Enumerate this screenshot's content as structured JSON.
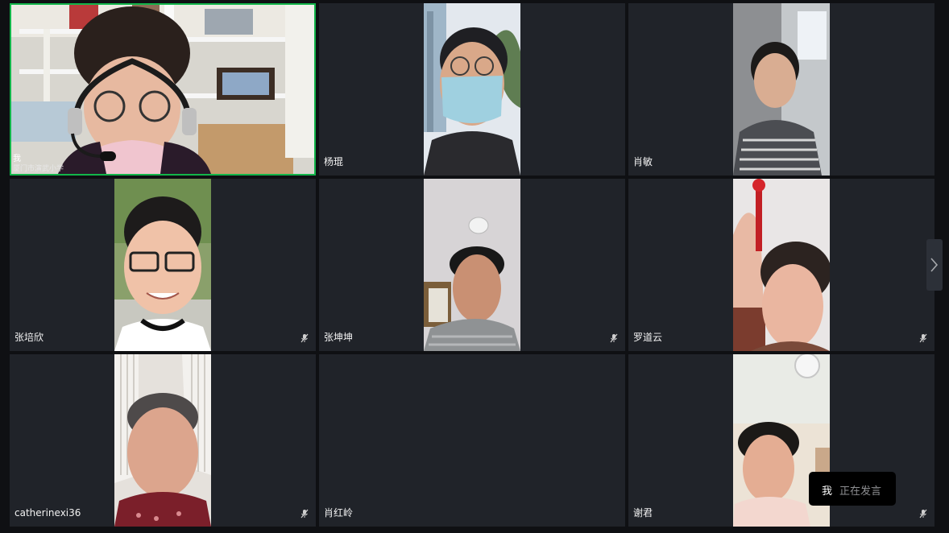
{
  "participants": [
    {
      "name": "我",
      "org": "厦门市演武小学",
      "self": true
    },
    {
      "name": "杨琨"
    },
    {
      "name": "肖敏"
    },
    {
      "name": "张培欣"
    },
    {
      "name": "张坤坤"
    },
    {
      "name": "罗道云"
    },
    {
      "name": "catherinexi36"
    },
    {
      "name": "肖红岭"
    },
    {
      "name": "谢君"
    }
  ],
  "toast": {
    "who": "我",
    "what": "正在发言"
  },
  "colors": {
    "background": "#0f1013",
    "tile": "#202329",
    "active_border": "#12b54a"
  }
}
